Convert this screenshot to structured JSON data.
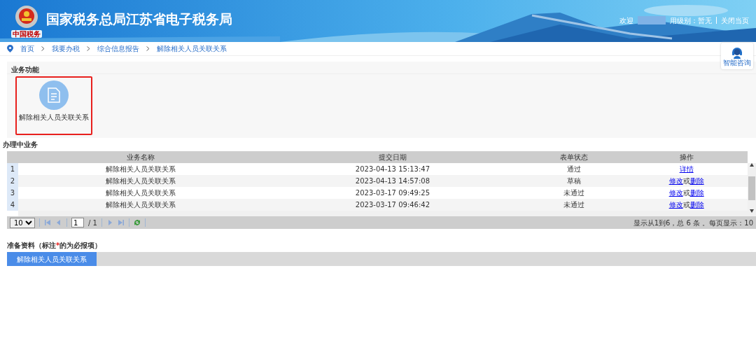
{
  "header": {
    "logo_caption": "中国税务",
    "title": "国家税务总局江苏省电子税务局",
    "welcome": "欢迎",
    "credit_level": "用级别：暂无",
    "close_link": "关闭当页"
  },
  "breadcrumb": [
    "首页",
    "我要办税",
    "综合信息报告",
    "解除相关人员关联关系"
  ],
  "consult": {
    "label": "智能咨询"
  },
  "functions": {
    "title": "业务功能",
    "items": [
      {
        "label": "解除相关人员关联关系",
        "selected": true
      }
    ]
  },
  "in_progress": {
    "title": "办理中业务",
    "table": {
      "columns": [
        "业务名称",
        "提交日期",
        "表单状态",
        "操作"
      ],
      "rows": [
        {
          "index": "1",
          "name": "解除相关人员关联关系",
          "date": "2023-04-13 15:13:47",
          "status": "通过",
          "actions": [
            {
              "kind": "link",
              "text": "详情"
            }
          ]
        },
        {
          "index": "2",
          "name": "解除相关人员关联关系",
          "date": "2023-04-13 14:57:08",
          "status": "草稿",
          "actions": [
            {
              "kind": "link",
              "text": "修改"
            },
            {
              "kind": "text",
              "text": "或"
            },
            {
              "kind": "link",
              "text": "删除"
            }
          ]
        },
        {
          "index": "3",
          "name": "解除相关人员关联关系",
          "date": "2023-03-17 09:49:25",
          "status": "未通过",
          "actions": [
            {
              "kind": "link",
              "text": "修改"
            },
            {
              "kind": "text",
              "text": "或"
            },
            {
              "kind": "link",
              "text": "删除"
            }
          ]
        },
        {
          "index": "4",
          "name": "解除相关人员关联关系",
          "date": "2023-03-17 09:46:42",
          "status": "未通过",
          "actions": [
            {
              "kind": "link",
              "text": "修改"
            },
            {
              "kind": "text",
              "text": "或"
            },
            {
              "kind": "link",
              "text": "删除"
            }
          ]
        }
      ]
    },
    "pager": {
      "page_size": "10",
      "page": "1",
      "page_total": "/ 1",
      "summary": "显示从1到6，总 6 条 。每页显示：10"
    }
  },
  "materials": {
    "title_before": "准备资料（标注",
    "required_mark": "*",
    "title_after": "的为必报项）",
    "tabs": [
      {
        "label": "解除相关人员关联关系",
        "selected": true
      }
    ]
  }
}
